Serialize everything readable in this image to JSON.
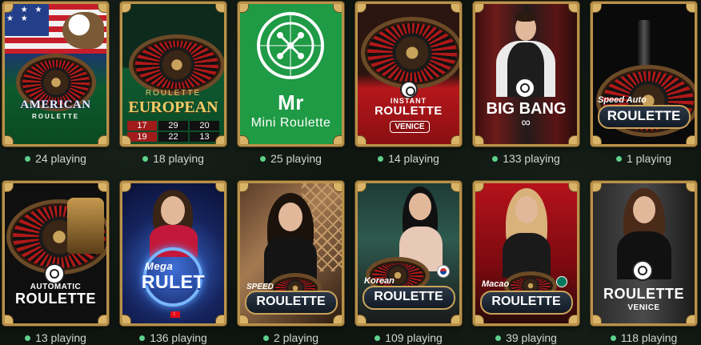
{
  "games": [
    {
      "name": "American Roulette",
      "label_main": "AMERICAN",
      "label_sub": "ROULETTE",
      "players": "24 playing"
    },
    {
      "name": "European Roulette",
      "label_top": "ROULETTE",
      "label_main": "EUROPEAN",
      "numbers": [
        "17",
        "29",
        "20",
        "19",
        "22",
        "13"
      ],
      "players": "18 playing"
    },
    {
      "name": "Mini Roulette",
      "label_logo": "Mr",
      "label_main": "Mini Roulette",
      "players": "25 playing"
    },
    {
      "name": "Instant Roulette Venice",
      "label_top": "INSTANT",
      "label_main": "ROULETTE",
      "label_sub": "VENICE",
      "players": "14 playing"
    },
    {
      "name": "Big Bang",
      "label_main": "BIG BANG",
      "label_sub": "∞",
      "players": "133 playing"
    },
    {
      "name": "Speed Auto Roulette",
      "label_top": "Speed Auto",
      "label_main": "ROULETTE",
      "players": "1 playing"
    },
    {
      "name": "Automatic Roulette",
      "label_top": "AUTOMATIC",
      "label_main": "ROULETTE",
      "players": "13 playing"
    },
    {
      "name": "Mega Rulet",
      "label_top": "Mega",
      "label_main": "RULET",
      "players": "136 playing"
    },
    {
      "name": "Speed Roulette",
      "label_top": "SPEED",
      "label_main": "ROULETTE",
      "players": "2 playing"
    },
    {
      "name": "Korean Roulette",
      "label_top": "Korean",
      "label_main": "ROULETTE",
      "players": "109 playing"
    },
    {
      "name": "Macao Roulette",
      "label_top": "Macao",
      "label_main": "ROULETTE",
      "players": "39 playing"
    },
    {
      "name": "Roulette Venice",
      "label_main": "ROULETTE",
      "label_sub": "VENICE",
      "players": "118 playing"
    }
  ],
  "colors": {
    "frame_gold": "#b8914a",
    "online_dot": "#5fd08a",
    "mini_green": "#1f9a45",
    "page_bg": "#0e1410"
  }
}
